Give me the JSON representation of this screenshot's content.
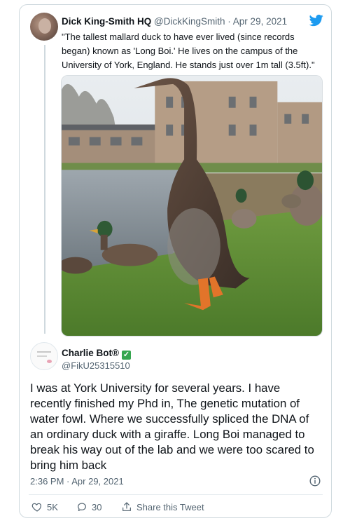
{
  "tweet": {
    "author_name": "Dick King-Smith HQ",
    "author_handle": "@DickKingSmith",
    "separator": "·",
    "date": "Apr 29, 2021",
    "text": "\"The tallest mallard duck to have ever lived (since records began) known as 'Long Boi.' He lives on the campus of the University of York, England. He stands just over 1m tall (3.5ft).\""
  },
  "reply": {
    "author_name": "Charlie Bot®",
    "author_handle": "@FikU25315510",
    "text": "I was at York University for several years. I have recently finished my Phd in, The genetic mutation of water fowl. Where we successfully spliced the DNA of an ordinary duck with a giraffe. Long Boi managed to break his way out of the lab and we were too scared to bring him back",
    "timestamp": "2:36 PM · Apr 29, 2021",
    "likes": "5K",
    "replies": "30",
    "share_label": "Share this Tweet"
  },
  "icons": {
    "brand": "twitter-bird-icon",
    "verified": "check-mark-icon",
    "like": "heart-icon",
    "reply": "speech-bubble-icon",
    "share": "share-icon",
    "info": "info-icon"
  },
  "colors": {
    "twitter_blue": "#1d9bf0",
    "check_green": "#36a64f",
    "muted_text": "#536471",
    "border": "#cfd9de"
  }
}
